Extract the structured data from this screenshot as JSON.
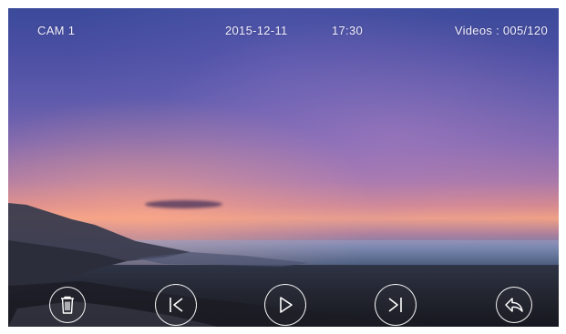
{
  "status_bar": {
    "camera": "CAM 1",
    "date": "2015-12-11",
    "time": "17:30",
    "videos": "Videos : 005/120"
  },
  "controls": [
    {
      "name": "delete-button",
      "icon": "trash-icon"
    },
    {
      "name": "previous-button",
      "icon": "skip-previous-icon"
    },
    {
      "name": "play-button",
      "icon": "play-icon"
    },
    {
      "name": "next-button",
      "icon": "skip-next-icon"
    },
    {
      "name": "back-button",
      "icon": "return-icon"
    }
  ],
  "colors": {
    "overlay_text": "#f2f0ff",
    "control_outline": "#ffffff"
  }
}
